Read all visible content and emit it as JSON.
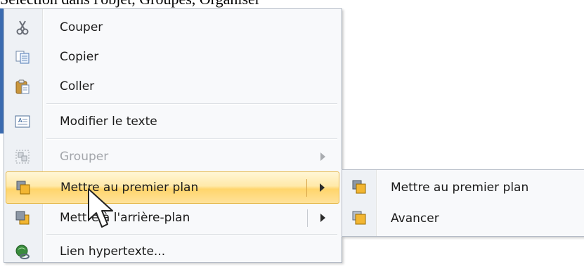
{
  "top_text": "Sélection dans l'objet, Groupes, Organiser",
  "menu": {
    "items": [
      {
        "label": "Couper",
        "icon": "scissors-icon"
      },
      {
        "label": "Copier",
        "icon": "copy-icon"
      },
      {
        "label": "Coller",
        "icon": "paste-icon"
      },
      {
        "label": "Modifier le texte",
        "icon": "edit-text-icon"
      },
      {
        "label": "Grouper",
        "icon": "group-icon",
        "disabled": true,
        "has_submenu": true
      },
      {
        "label": "Mettre au premier plan",
        "icon": "bring-to-front-icon",
        "highlighted": true,
        "has_submenu": true
      },
      {
        "label": "Mettre à l'arrière-plan",
        "icon": "send-to-back-icon",
        "has_submenu": true
      },
      {
        "label": "Lien hypertexte...",
        "icon": "hyperlink-icon"
      }
    ]
  },
  "submenu": {
    "items": [
      {
        "label": "Mettre au premier plan",
        "icon": "bring-to-front-icon"
      },
      {
        "label": "Avancer",
        "icon": "bring-forward-icon"
      }
    ]
  },
  "colors": {
    "highlight_top": "#fff6d6",
    "highlight_bottom": "#ffd56c",
    "highlight_border": "#e6b849",
    "disabled_text": "#a3a6ab"
  }
}
